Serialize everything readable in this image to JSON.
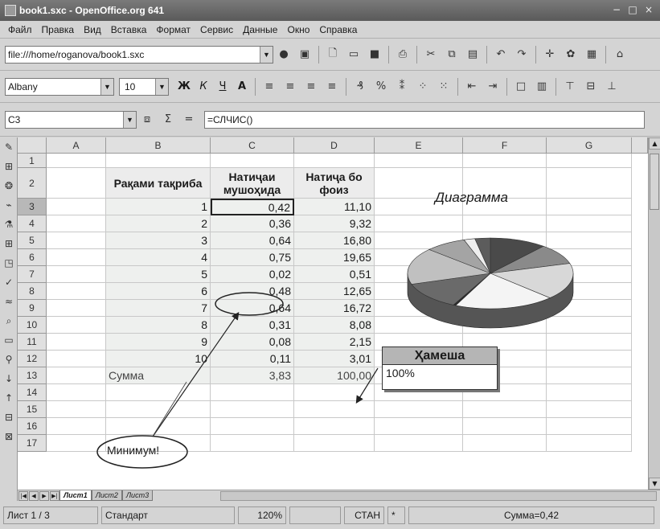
{
  "window": {
    "title": "book1.sxc - OpenOffice.org 641",
    "controls": [
      "−",
      "□",
      "×"
    ]
  },
  "menu": [
    "Файл",
    "Правка",
    "Вид",
    "Вставка",
    "Формат",
    "Сервис",
    "Данные",
    "Окно",
    "Справка"
  ],
  "url": {
    "value": "file:///home/roganova/book1.sxc"
  },
  "font": {
    "name": "Albany",
    "size": "10"
  },
  "format_buttons": [
    "Ж",
    "К",
    "Ч",
    "A"
  ],
  "name_box": {
    "value": "C3"
  },
  "formula": {
    "sigma": "Σ",
    "equals": "=",
    "value": "=СЛЧИС()"
  },
  "columns": [
    "A",
    "B",
    "C",
    "D",
    "E",
    "F",
    "G"
  ],
  "rows": [
    "1",
    "2",
    "3",
    "4",
    "5",
    "6",
    "7",
    "8",
    "9",
    "10",
    "11",
    "12",
    "13",
    "14",
    "15",
    "16",
    "17"
  ],
  "table": {
    "headers": [
      "Рақами тақриба",
      "Натиҷаи мушоҳида",
      "Натиҷа бо фоиз"
    ],
    "data": [
      [
        "1",
        "0,42",
        "11,10"
      ],
      [
        "2",
        "0,36",
        "9,32"
      ],
      [
        "3",
        "0,64",
        "16,80"
      ],
      [
        "4",
        "0,75",
        "19,65"
      ],
      [
        "5",
        "0,02",
        "0,51"
      ],
      [
        "6",
        "0,48",
        "12,65"
      ],
      [
        "7",
        "0,64",
        "16,72"
      ],
      [
        "8",
        "0,31",
        "8,08"
      ],
      [
        "9",
        "0,08",
        "2,15"
      ],
      [
        "10",
        "0,11",
        "3,01"
      ]
    ],
    "sum_label": "Сумма",
    "sum_c": "3,83",
    "sum_d": "100,00"
  },
  "chart": {
    "title": "Диаграмма",
    "type": "pie-3d",
    "values": [
      11.1,
      9.32,
      16.8,
      19.65,
      0.51,
      12.65,
      16.72,
      8.08,
      2.15,
      3.01
    ],
    "colors": [
      "#4a4a4a",
      "#8a8a8a",
      "#d8d8d8",
      "#f4f4f4",
      "#2a2a2a",
      "#6a6a6a",
      "#c0c0c0",
      "#a4a4a4",
      "#ededed",
      "#5c5c5c"
    ]
  },
  "callout": {
    "title": "Ҳамеша",
    "value": "100%"
  },
  "annotation": {
    "label": "Минимум!"
  },
  "sheets": [
    "Лист1",
    "Лист2",
    "Лист3"
  ],
  "status": {
    "sheet": "Лист 1 / 3",
    "style": "Стандарт",
    "zoom": "120%",
    "mode": "СТАН",
    "mod": "*",
    "sum": "Сумма=0,42"
  }
}
